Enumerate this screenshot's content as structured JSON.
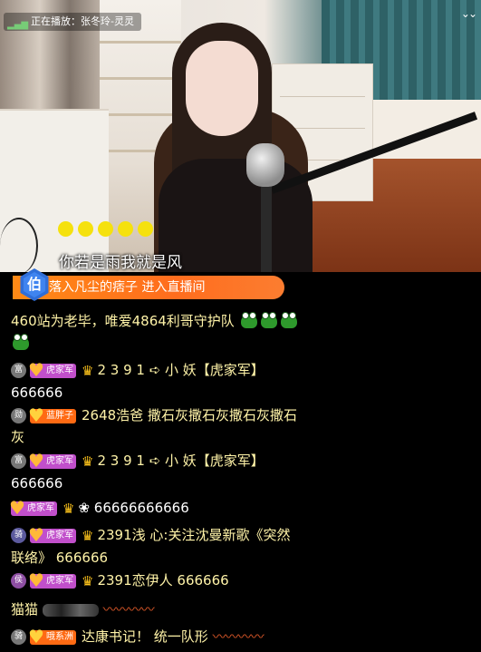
{
  "stream": {
    "now_playing": "正在播放：张冬玲-灵灵",
    "lyric": "你若是雨我就是风"
  },
  "enter": {
    "rank_label": "伯",
    "text": "落入凡尘的痞子 进入直播间"
  },
  "chat": [
    {
      "level": "",
      "badge": "",
      "content": "460站为老毕，唯爱4864利哥守护队"
    },
    {
      "level": "富",
      "badge": "虎家军",
      "content": "2 3 9 1 ➪ 小  妖【虎家军】",
      "content2": "666666"
    },
    {
      "level": "勋",
      "badge": "蓝胖子",
      "content": "2648浩爸  撒石灰撒石灰撒石灰撒石",
      "content2": "灰"
    },
    {
      "level": "富",
      "badge": "虎家军",
      "content": "2 3 9 1 ➪ 小  妖【虎家军】",
      "content2": "666666"
    },
    {
      "level": "",
      "badge": "虎家军",
      "content": "❀ 66666666666"
    },
    {
      "level": "骑",
      "badge": "虎家军",
      "content": "2391浅 心:关注沈曼新歌《突然",
      "content2": "联络》 666666"
    },
    {
      "level": "侯",
      "badge": "虎家军",
      "content": "2391恋伊人 666666"
    },
    {
      "level": "",
      "badge": "",
      "content": "猫猫"
    },
    {
      "level": "骑",
      "badge": "哦系洲",
      "content": "达康书记！ 统一队形"
    }
  ],
  "icons": {
    "collapse": "chevron-double-down-icon",
    "fan_badge": "heart-badge-icon",
    "crown": "crown-icon",
    "frog": "frog-emoji-icon",
    "sausage": "sausage-emoji-icon"
  },
  "colors": {
    "banner": "#ff7a1f",
    "badge_purple": "#c14fcb",
    "badge_orange": "#ff6a13",
    "rank_blue": "#3f84f0",
    "lyric_dots": "#f5e10e"
  }
}
